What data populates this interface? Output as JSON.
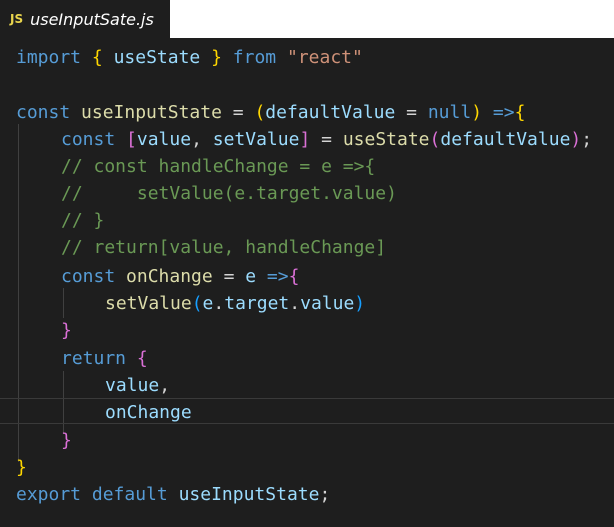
{
  "tab": {
    "icon_text": "JS",
    "file_name": "useInputSate.js"
  },
  "code": {
    "l1": {
      "kw1": "import",
      "b1": "{",
      "name": "useState",
      "b2": "}",
      "kw2": "from",
      "str": "\"react\""
    },
    "l3": {
      "kw": "const",
      "fn": "useInputState",
      "eq": " = ",
      "p1": "(",
      "param": "defaultValue",
      "eq2": " = ",
      "nul": "null",
      "p2": ")",
      "arrow": " =>",
      "b": "{"
    },
    "l4": {
      "kw": "const",
      "b1": "[",
      "v1": "value",
      "comma": ", ",
      "v2": "setValue",
      "b2": "]",
      "eq": " = ",
      "fn": "useState",
      "p1": "(",
      "arg": "defaultValue",
      "p2": ")",
      "semi": ";"
    },
    "l5": "// const handleChange = e =>{",
    "l6": "//     setValue(e.target.value)",
    "l7": "// }",
    "l8": "// return[value, handleChange]",
    "l9": {
      "kw": "const",
      "fn": "onChange",
      "eq": " = ",
      "param": "e",
      "arrow": " =>",
      "b": "{"
    },
    "l10": {
      "fn": "setValue",
      "p1": "(",
      "obj": "e",
      "dot1": ".",
      "prop1": "target",
      "dot2": ".",
      "prop2": "value",
      "p2": ")"
    },
    "l11": "}",
    "l12": {
      "kw": "return",
      "b": "{"
    },
    "l13": {
      "v": "value",
      "comma": ","
    },
    "l14": "onChange",
    "l15": "}",
    "l16": "}",
    "l17": {
      "kw1": "export",
      "kw2": "default",
      "name": "useInputState",
      "semi": ";"
    }
  },
  "colors": {
    "keyword": "#569cd6",
    "function": "#dcdcaa",
    "variable": "#9cdcfe",
    "string": "#ce9178",
    "comment": "#6a9955",
    "bracket_level1": "#ffd700",
    "bracket_level2": "#da70d6",
    "bracket_level3": "#179fff",
    "background": "#1e1e1e"
  }
}
